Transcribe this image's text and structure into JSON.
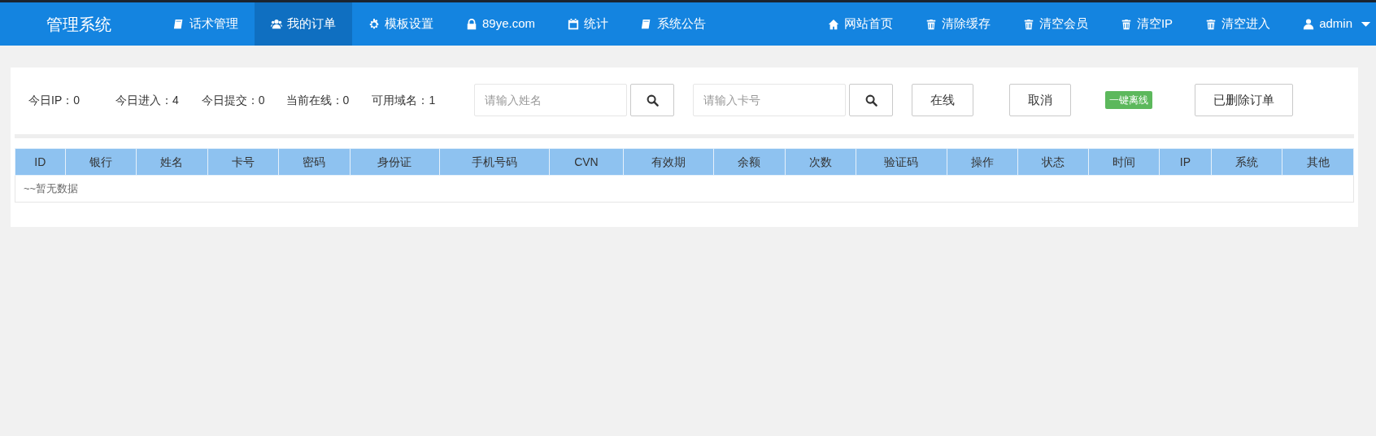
{
  "navbar": {
    "brand": "管理系统",
    "left_items": [
      {
        "label": "话术管理",
        "kind": "book",
        "selected": false
      },
      {
        "label": "我的订单",
        "kind": "users",
        "selected": true
      },
      {
        "label": "模板设置",
        "kind": "gear",
        "selected": false
      },
      {
        "label": "89ye.com",
        "kind": "lock",
        "selected": false
      },
      {
        "label": "统计",
        "kind": "calendar",
        "selected": false
      },
      {
        "label": "系统公告",
        "kind": "book",
        "selected": false
      }
    ],
    "right_items": [
      {
        "label": "网站首页",
        "kind": "home"
      },
      {
        "label": "清除缓存",
        "kind": "trash"
      },
      {
        "label": "清空会员",
        "kind": "trash"
      },
      {
        "label": "清空IP",
        "kind": "trash"
      },
      {
        "label": "清空进入",
        "kind": "trash"
      }
    ],
    "user_menu": {
      "label": "admin"
    }
  },
  "stats": [
    "今日IP：0",
    "今日进入：4",
    "今日提交：0",
    "当前在线：0",
    "可用域名：1"
  ],
  "search_fields": [
    {
      "placeholder": "请输入姓名"
    },
    {
      "placeholder": "请输入卡号"
    }
  ],
  "actions": [
    {
      "label": "在线",
      "kind": "button"
    },
    {
      "label": "取消",
      "kind": "button"
    },
    {
      "label": "一键离线",
      "kind": "badge"
    },
    {
      "label": "已删除订单",
      "kind": "button"
    }
  ],
  "table": {
    "columns": [
      "ID",
      "银行",
      "姓名",
      "卡号",
      "密码",
      "身份证",
      "手机号码",
      "CVN",
      "有效期",
      "余额",
      "次数",
      "验证码",
      "操作",
      "状态",
      "时间",
      "IP",
      "系统",
      "其他"
    ],
    "empty_message": "~~暂无数据"
  }
}
